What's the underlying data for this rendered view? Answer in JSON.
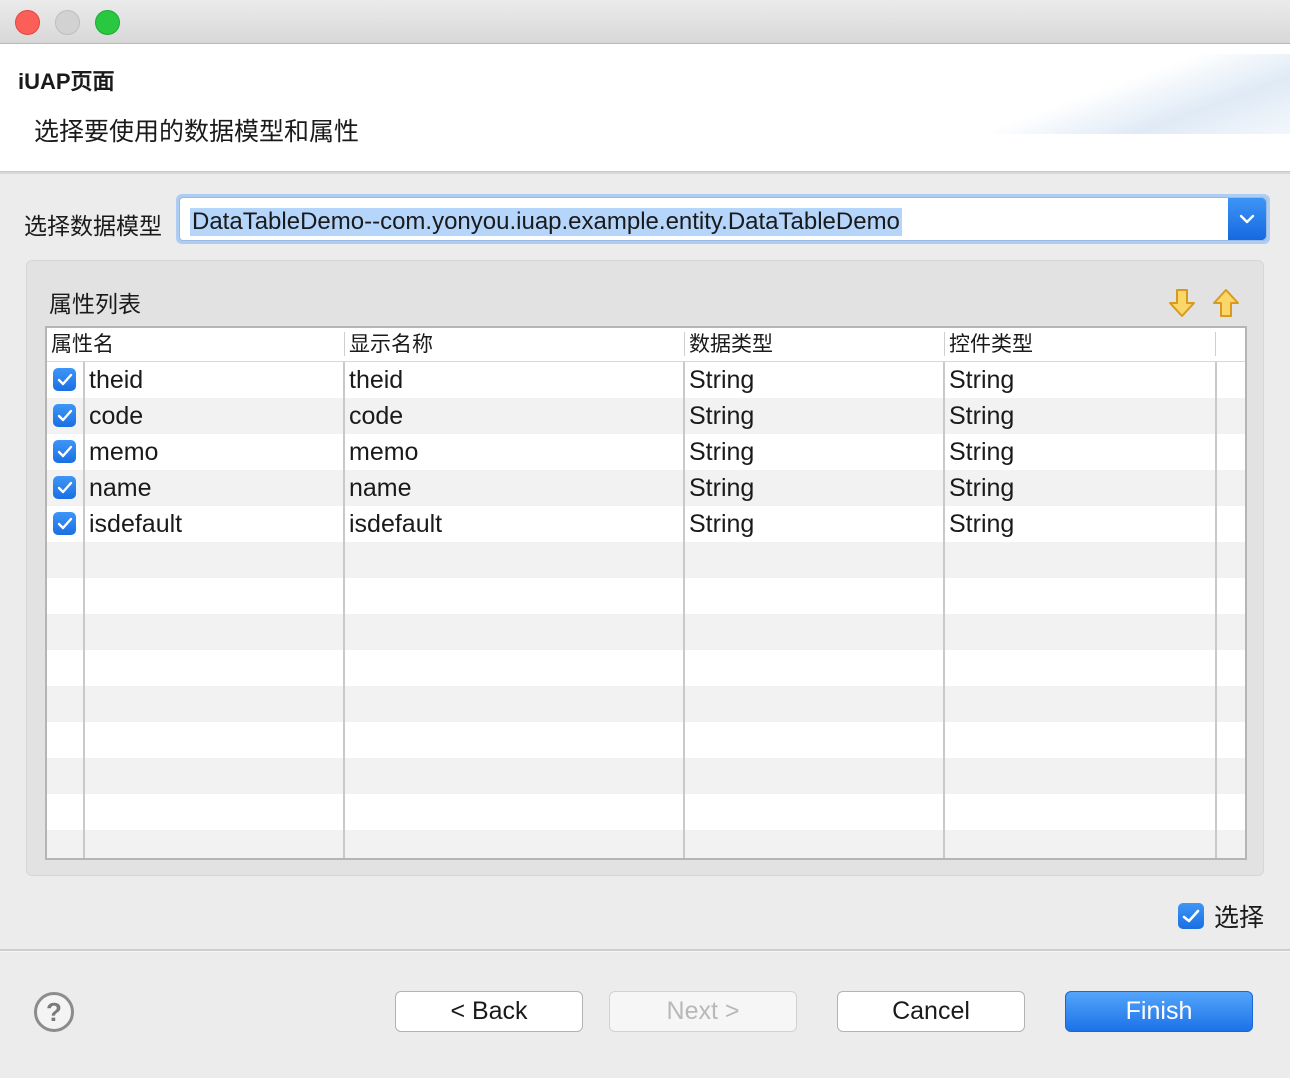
{
  "window": {
    "buttons": [
      "close",
      "minimize",
      "maximize"
    ]
  },
  "header": {
    "title": "iUAP页面",
    "description": "选择要使用的数据模型和属性"
  },
  "model": {
    "label": "选择数据模型",
    "value": "DataTableDemo--com.yonyou.iuap.example.entity.DataTableDemo",
    "dropdown_icon": "chevron-down-icon"
  },
  "attributes": {
    "group_title": "属性列表",
    "move_down_icon": "arrow-down-icon",
    "move_up_icon": "arrow-up-icon",
    "columns": [
      "属性名",
      "显示名称",
      "数据类型",
      "控件类型"
    ],
    "rows": [
      {
        "checked": true,
        "name": "theid",
        "display": "theid",
        "data_type": "String",
        "control_type": "String"
      },
      {
        "checked": true,
        "name": "code",
        "display": "code",
        "data_type": "String",
        "control_type": "String"
      },
      {
        "checked": true,
        "name": "memo",
        "display": "memo",
        "data_type": "String",
        "control_type": "String"
      },
      {
        "checked": true,
        "name": "name",
        "display": "name",
        "data_type": "String",
        "control_type": "String"
      },
      {
        "checked": true,
        "name": "isdefault",
        "display": "isdefault",
        "data_type": "String",
        "control_type": "String"
      }
    ]
  },
  "select_all": {
    "label": "选择",
    "checked": true
  },
  "footer": {
    "help_icon": "help-icon",
    "back_label": "< Back",
    "next_label": "Next >",
    "cancel_label": "Cancel",
    "finish_label": "Finish"
  },
  "colors": {
    "accent": "#1c72e8",
    "close": "#fc5f57",
    "maximize": "#2ac840"
  }
}
